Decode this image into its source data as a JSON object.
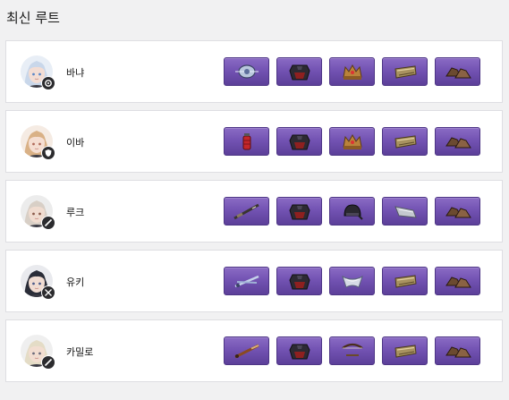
{
  "section": {
    "title": "최신 루트"
  },
  "routes": [
    {
      "name": "바냐",
      "avatar_icon": "silver-haired-girl-portrait",
      "class_icon": "support-class-icon",
      "items": [
        "orb-weapon-icon",
        "chest-armor-icon",
        "crown-icon",
        "bracer-icon",
        "boots-icon"
      ]
    },
    {
      "name": "이바",
      "avatar_icon": "blonde-girl-portrait",
      "class_icon": "shield-class-icon",
      "items": [
        "grenade-weapon-icon",
        "chest-armor-icon",
        "crown-icon",
        "bracer-icon",
        "boots-icon"
      ]
    },
    {
      "name": "루크",
      "avatar_icon": "white-haired-boy-portrait",
      "class_icon": "blade-class-icon",
      "items": [
        "rifle-weapon-icon",
        "chest-armor-icon",
        "helmet-icon",
        "arm-guard-icon",
        "boots-icon"
      ]
    },
    {
      "name": "유키",
      "avatar_icon": "dark-haired-boy-portrait",
      "class_icon": "dual-sword-class-icon",
      "items": [
        "dual-blade-weapon-icon",
        "chest-armor-icon",
        "cloak-icon",
        "bracer-icon",
        "boots-icon"
      ]
    },
    {
      "name": "카밀로",
      "avatar_icon": "blonde-boy-portrait",
      "class_icon": "blade-class-icon",
      "items": [
        "rapier-weapon-icon",
        "chest-armor-icon",
        "bow-icon",
        "bracer-icon",
        "boots-icon"
      ]
    }
  ]
}
